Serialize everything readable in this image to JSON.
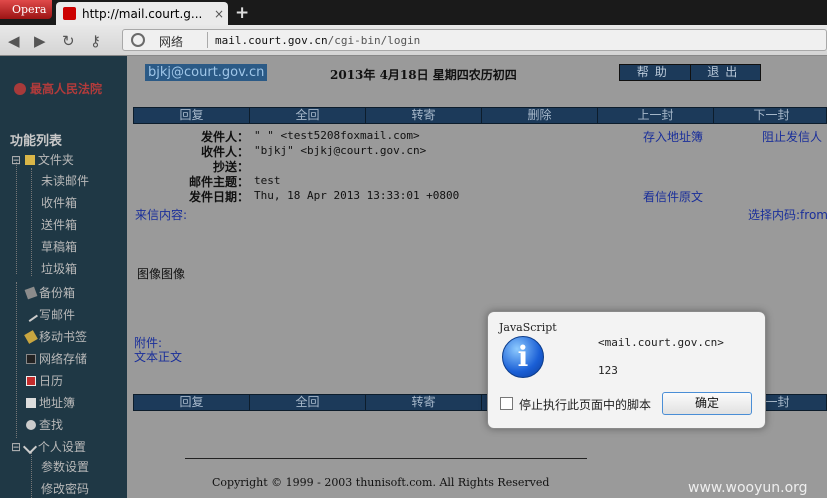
{
  "browser": {
    "menu_label": "Opera",
    "tab_title": "http://mail.court.g...",
    "tab_close": "×",
    "new_tab": "+",
    "zone_label": "网络",
    "url_host": "mail.court.gov.cn",
    "url_path": "/cgi-bin/login"
  },
  "sidebar": {
    "logo_text": "最高人民法院",
    "title": "功能列表",
    "items": [
      {
        "label": "文件夹",
        "expander": "⊟"
      },
      {
        "label": "未读邮件"
      },
      {
        "label": "收件箱"
      },
      {
        "label": "送件箱"
      },
      {
        "label": "草稿箱"
      },
      {
        "label": "垃圾箱"
      },
      {
        "label": "备份箱"
      },
      {
        "label": "写邮件"
      },
      {
        "label": "移动书签"
      },
      {
        "label": "网络存储"
      },
      {
        "label": "日历"
      },
      {
        "label": "地址簿"
      },
      {
        "label": "查找"
      },
      {
        "label": "个人设置",
        "expander": "⊟"
      },
      {
        "label": "参数设置"
      },
      {
        "label": "修改密码"
      }
    ]
  },
  "header": {
    "user_email": "bjkj@court.gov.cn",
    "date": "2013年 4月18日 星期四农历初四",
    "buttons": [
      "帮助",
      "退出"
    ]
  },
  "toolbar": {
    "actions": [
      "回复",
      "全回",
      "转寄",
      "删除",
      "上一封",
      "下一封"
    ]
  },
  "mail": {
    "labels": {
      "from": "发件人：",
      "to": "收件人：",
      "cc": "抄送：",
      "subject": "邮件主题：",
      "date": "发件日期："
    },
    "from": "\"   \" <test5208foxmail.com>",
    "to": "\"bjkj\" <bjkj@court.gov.cn>",
    "cc": "",
    "subject": "test",
    "date": "Thu, 18 Apr 2013 13:33:01 +0800",
    "add_to_addressbook": "存入地址簿",
    "block_sender": "阻止发信人",
    "view_source": "看信件原文",
    "content_label": "来信内容:",
    "charset_label": "选择内码:from",
    "body_text": "图像图像",
    "attachment_label": "附件:",
    "attachment_name": "文本正文"
  },
  "footer": {
    "copyright": "Copyright © 1999 - 2003 thunisoft.com. All Rights Reserved"
  },
  "dialog": {
    "title": "JavaScript",
    "icon_glyph": "i",
    "host": "<mail.court.gov.cn>",
    "message": "123",
    "checkbox_label": "停止执行此页面中的脚本",
    "ok_label": "确定"
  },
  "watermark": "www.wooyun.org"
}
